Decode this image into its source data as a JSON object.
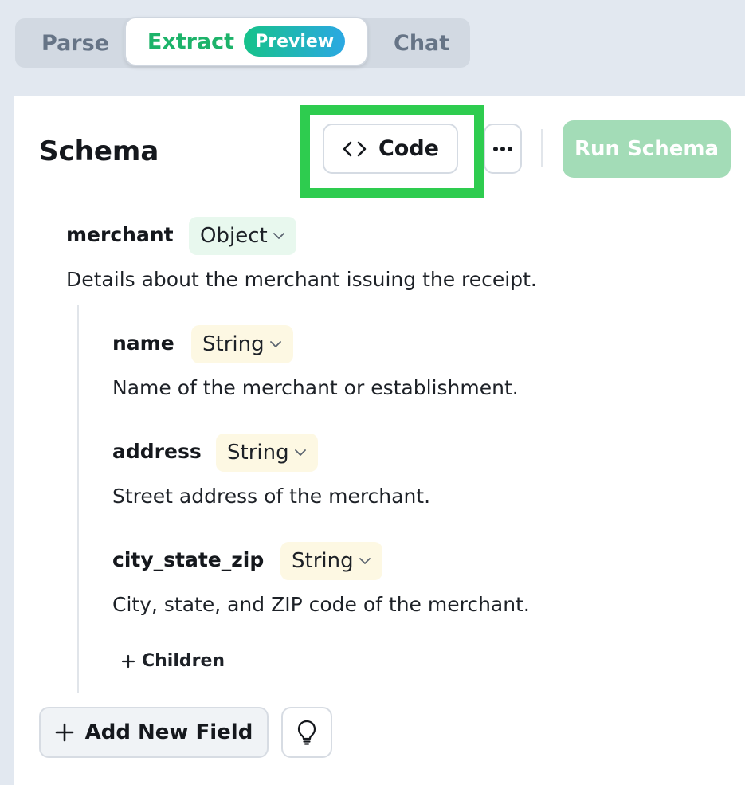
{
  "tabs": {
    "parse": "Parse",
    "extract": "Extract",
    "extract_badge": "Preview",
    "chat": "Chat",
    "active": "Extract"
  },
  "toolbar": {
    "title": "Schema",
    "code_label": "Code",
    "more_label": "···",
    "run_label": "Run Schema"
  },
  "schema": {
    "root": {
      "name": "merchant",
      "type": "Object",
      "description": "Details about the merchant issuing the receipt."
    },
    "children": [
      {
        "name": "name",
        "type": "String",
        "description": "Name of the merchant or establishment."
      },
      {
        "name": "address",
        "type": "String",
        "description": "Street address of the merchant."
      },
      {
        "name": "city_state_zip",
        "type": "String",
        "description": "City, state, and ZIP code of the merchant."
      }
    ],
    "add_children_label": "Children"
  },
  "footer": {
    "add_field_label": "Add New Field"
  },
  "colors": {
    "accent_green": "#1db36a",
    "highlight_box": "#2ecc4f",
    "run_button_disabled": "#a3dcb7",
    "object_pill": "#e8f8ee",
    "string_pill": "#fdf8e3"
  },
  "icons": {
    "code": "code-brackets-icon",
    "more": "more-horizontal-icon",
    "chevron": "chevron-down-icon",
    "plus": "plus-icon",
    "bulb": "lightbulb-icon"
  }
}
